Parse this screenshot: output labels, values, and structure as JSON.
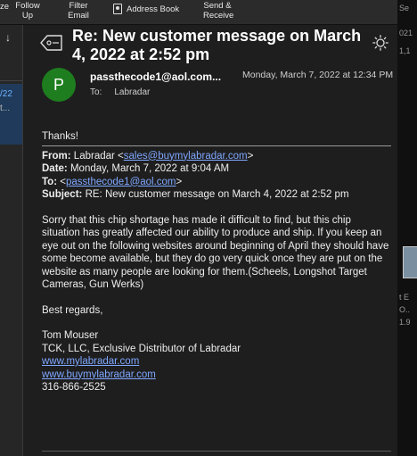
{
  "toolbar": {
    "reply_partial": "ze",
    "reply_partial_2": "Up",
    "follow_up": "Follow",
    "follow_up_2": "Up",
    "filter_email": "Filter",
    "filter_email_2": "Email",
    "address_book": "Address Book",
    "send_receive": "Send &",
    "send_receive_2": "Receive"
  },
  "left_pane": {
    "date": "/22",
    "preview": "t..."
  },
  "right_edge": {
    "lines": [
      "Se",
      "021",
      "1,1",
      "t E",
      "O..",
      "1.9"
    ]
  },
  "message": {
    "subject": "Re: New customer message on March 4, 2022 at 2:52 pm",
    "avatar_letter": "P",
    "from": "passthecode1@aol.com...",
    "date": "Monday, March 7, 2022 at 12:34 PM",
    "to_label": "To:",
    "to": "Labradar"
  },
  "body": {
    "thanks": "Thanks!",
    "from_label": "From:",
    "from_name": "Labradar <",
    "from_email": "sales@buymylabradar.com",
    "from_close": ">",
    "date_label": "Date:",
    "date_value": "Monday, March 7, 2022 at 9:04 AM",
    "to_label": "To:",
    "to_open": "<",
    "to_email": "passthecode1@aol.com",
    "to_close": ">",
    "subject_label": "Subject:",
    "subject_value": "RE: New customer message on March 4, 2022 at 2:52 pm",
    "paragraph": "Sorry that this chip shortage has made it difficult to find, but this chip situation has greatly affected our ability to produce and ship. If you keep an eye out on the following websites around beginning of April they should have some become available, but they do go very quick once they are put on the website as many people are looking for them.(Scheels, Longshot Target Cameras, Gun Werks)",
    "regards": "Best regards,",
    "sig_name": "Tom Mouser",
    "sig_company": "TCK, LLC, Exclusive Distributor of Labradar",
    "sig_link1": "www.mylabradar.com",
    "sig_link2": "www.buymylabradar.com",
    "sig_phone": "316-866-2525"
  },
  "colors": {
    "background": "#1e1e1e",
    "avatar": "#1e7d1e",
    "link": "#7fa7ff",
    "selection": "#1f3a5a"
  }
}
